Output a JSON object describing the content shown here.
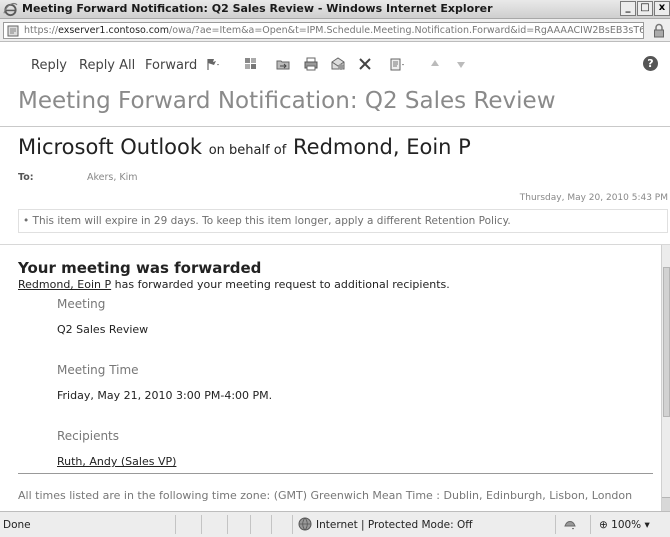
{
  "window": {
    "title": "Meeting Forward Notification: Q2 Sales Review - Windows Internet Explorer",
    "controls": [
      "_",
      "□",
      "x"
    ]
  },
  "address": {
    "url_prefix": "https://",
    "url_host": "exserver1.contoso.com",
    "url_rest": "/owa/?ae=Item&a=Open&t=IPM.Schedule.Meeting.Notification.Forward&id=RgAAAACIW2BsEB3sT6"
  },
  "toolbar": {
    "reply": "Reply",
    "reply_all": "Reply All",
    "forward": "Forward",
    "icons": [
      "flag-icon",
      "categories-icon",
      "move-icon",
      "print-icon",
      "junk-icon",
      "delete-icon",
      "more-actions-icon",
      "previous-icon",
      "next-icon",
      "help-icon"
    ],
    "help": "?"
  },
  "message": {
    "title": "Meeting Forward Notification: Q2 Sales Review",
    "sender_primary": "Microsoft Outlook",
    "on_behalf": "on behalf of",
    "sender_secondary": "Redmond, Eoin P",
    "to_label": "To:",
    "to_value": "Akers, Kim",
    "date": "Thursday, May 20, 2010 5:43 PM",
    "expiry": "• This item will expire in 29 days. To keep this item longer, apply a different Retention Policy."
  },
  "body": {
    "heading": "Your meeting was forwarded",
    "forwarder": "Redmond, Eoin P",
    "forward_text": "has forwarded your meeting request to additional recipients.",
    "meeting_label": "Meeting",
    "meeting_value": "Q2 Sales Review",
    "time_label": "Meeting Time",
    "time_value": "Friday, May 21, 2010 3:00 PM-4:00 PM.",
    "recipients_label": "Recipients",
    "recipient": "Ruth, Andy (Sales VP)",
    "timezone_note": "All times listed are in the following time zone: (GMT) Greenwich Mean Time : Dublin, Edinburgh, Lisbon, London"
  },
  "status": {
    "text": "Done",
    "zone": "Internet | Protected Mode: Off",
    "zoom": "100%"
  }
}
